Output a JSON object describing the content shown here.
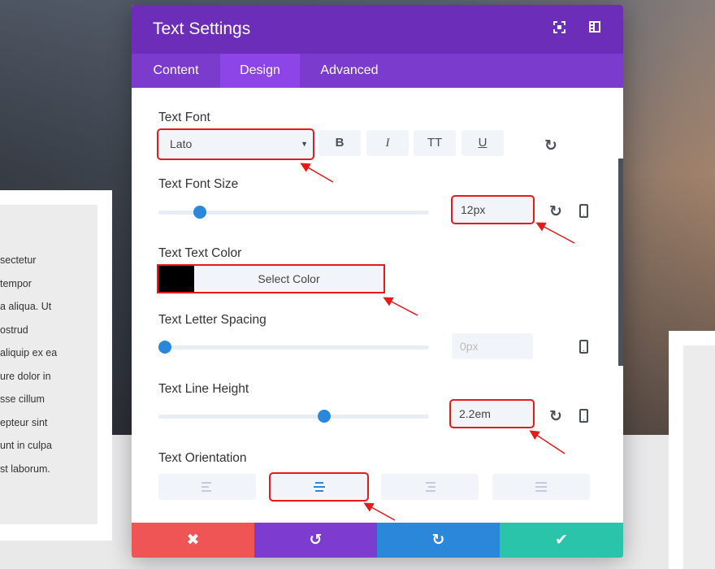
{
  "modal": {
    "title": "Text Settings",
    "header_icons": [
      "fullscreen-icon",
      "sidebar-layout-icon"
    ],
    "tabs": [
      {
        "label": "Content"
      },
      {
        "label": "Design",
        "active": true
      },
      {
        "label": "Advanced"
      }
    ],
    "text_font": {
      "label": "Text Font",
      "value": "Lato",
      "style_buttons": [
        "B",
        "I",
        "TT",
        "U"
      ]
    },
    "font_size": {
      "label": "Text Font Size",
      "value": "12px",
      "slider_percent": 13
    },
    "text_color": {
      "label": "Text Text Color",
      "swatch": "#000000",
      "button": "Select Color"
    },
    "letter_spacing": {
      "label": "Text Letter Spacing",
      "placeholder": "0px",
      "slider_percent": 0
    },
    "line_height": {
      "label": "Text Line Height",
      "value": "2.2em",
      "slider_percent": 59
    },
    "orientation": {
      "label": "Text Orientation",
      "options": [
        "left",
        "center",
        "right",
        "justify"
      ],
      "selected": "center"
    },
    "footer": {
      "colors": {
        "cancel": "#ef5555",
        "undo": "#7d3bcf",
        "redo": "#2b87da",
        "save": "#29c4a9"
      }
    }
  },
  "background_text": [
    "sectetur",
    "tempor",
    "a aliqua. Ut",
    "ostrud",
    "aliquip ex ea",
    "ure dolor in",
    "sse cillum",
    "epteur sint",
    "unt in culpa",
    "st laborum."
  ],
  "colors": {
    "header": "#6c2eb9",
    "tabs": "#7b3bcd",
    "active_tab": "#8e45e8",
    "highlight": "#e61a1a",
    "accent": "#2b87da"
  }
}
